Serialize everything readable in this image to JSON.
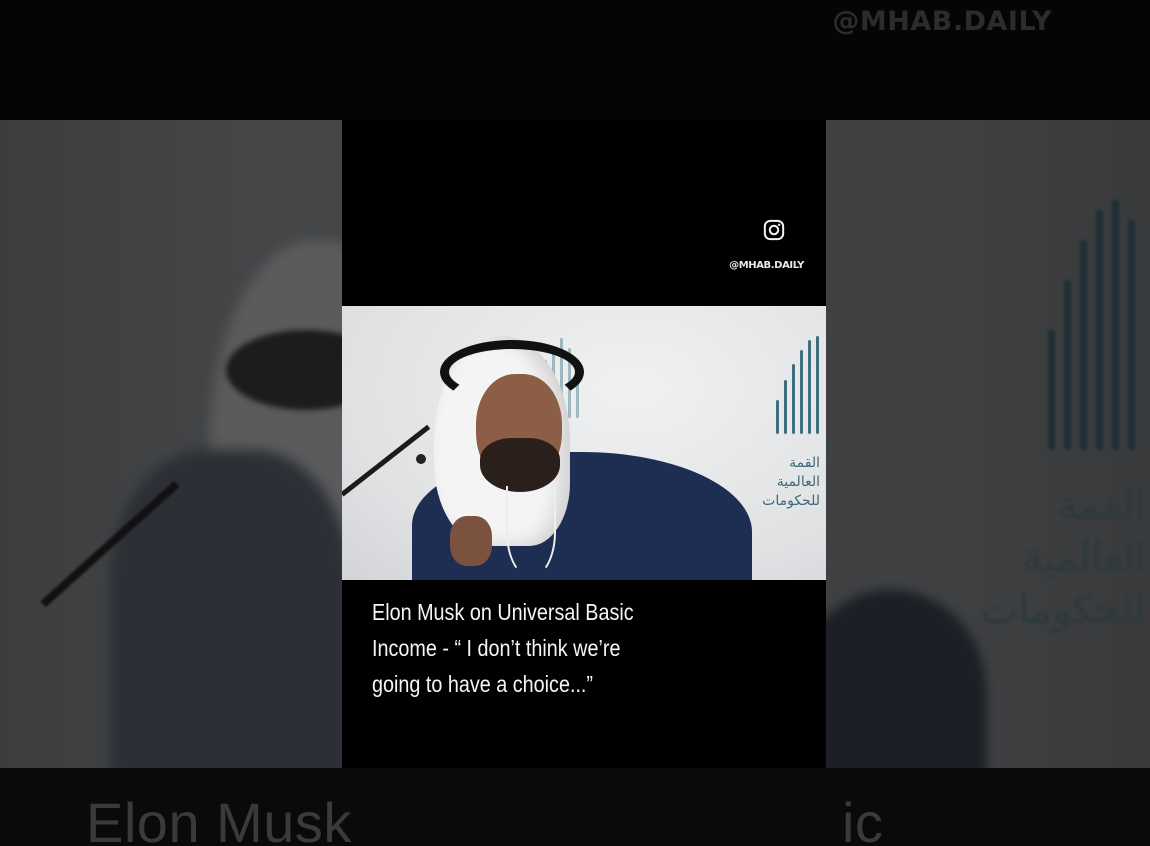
{
  "background": {
    "watermark": "@MHAB.DAILY",
    "caption_left": "Elon Musk",
    "caption_right": "ic",
    "logo_arabic": [
      "القمة",
      "العالمية",
      "للحكومات"
    ]
  },
  "video": {
    "platform_icon": "instagram-icon",
    "handle": "@MHAB.DAILY",
    "caption_lines": [
      "Elon Musk on Universal Basic",
      "Income - “ I don’t think we’re",
      "going to have a choice...”"
    ],
    "logo_arabic": [
      "القمة",
      "العالمية",
      "للحكومات"
    ]
  },
  "colors": {
    "background": "#000000",
    "caption_text": "#f5f5f5",
    "logo_accent": "#3e6f7f",
    "suit": "#1e2d52"
  }
}
